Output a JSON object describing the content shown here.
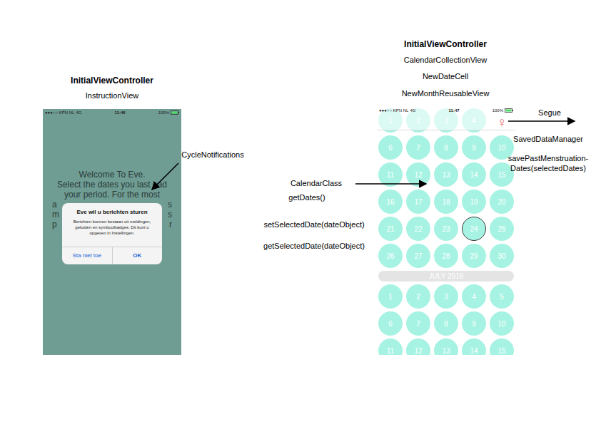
{
  "instruction_screen": {
    "labels": [
      "InitialViewController",
      "InstructionView"
    ],
    "status_bar": {
      "carrier": "●●●○○ KPN NL",
      "network": "4G",
      "time": "11:46",
      "battery": "100%"
    },
    "lines": [
      "Welcome To Eve.",
      "Select the dates you last had",
      "your period. For the most"
    ],
    "obscured_lines": [
      {
        "left": "a",
        "right": "s"
      },
      {
        "left": "m",
        "right": "s"
      },
      {
        "left": "p",
        "right": "r"
      }
    ],
    "alert": {
      "title": "Eve wil u berichten sturen",
      "message": "Berichten kunnen bestaan uit meldingen, geluiden en symboolbadges. Dit kunt u opgeven in Instellingen.",
      "buttons": [
        {
          "label": "Sta niet toe",
          "primary": false
        },
        {
          "label": "OK",
          "primary": true
        }
      ]
    }
  },
  "calendar_screen": {
    "labels": [
      "InitialViewController",
      "CalendarCollectionView",
      "NewDateCell",
      "NewMonthReusableView"
    ],
    "status_bar": {
      "carrier": "●●●○○ KPN NL",
      "network": "4G",
      "time": "11:47",
      "battery": "100%"
    },
    "menu_button": "♀",
    "months": [
      {
        "header": null,
        "days": [
          {
            "label": "1",
            "selected": false
          },
          {
            "label": "2",
            "selected": false
          },
          {
            "label": "3",
            "selected": false
          },
          {
            "label": "4",
            "selected": false
          },
          {
            "label": "6",
            "selected": false
          },
          {
            "label": "7",
            "selected": false
          },
          {
            "label": "8",
            "selected": false
          },
          {
            "label": "9",
            "selected": false
          },
          {
            "label": "10",
            "selected": false
          },
          {
            "label": "11",
            "selected": false
          },
          {
            "label": "12",
            "selected": false
          },
          {
            "label": "13",
            "selected": false
          },
          {
            "label": "14",
            "selected": false
          },
          {
            "label": "15",
            "selected": false
          },
          {
            "label": "16",
            "selected": false
          },
          {
            "label": "17",
            "selected": false
          },
          {
            "label": "18",
            "selected": false
          },
          {
            "label": "19",
            "selected": false
          },
          {
            "label": "20",
            "selected": false
          },
          {
            "label": "21",
            "selected": false
          },
          {
            "label": "22",
            "selected": false
          },
          {
            "label": "23",
            "selected": false
          },
          {
            "label": "24",
            "selected": true
          },
          {
            "label": "25",
            "selected": false
          },
          {
            "label": "26",
            "selected": false
          },
          {
            "label": "27",
            "selected": false
          },
          {
            "label": "28",
            "selected": false
          },
          {
            "label": "29",
            "selected": false
          },
          {
            "label": "30",
            "selected": false
          }
        ]
      },
      {
        "header": "JULY 2016",
        "days": [
          {
            "label": "1",
            "selected": false
          },
          {
            "label": "2",
            "selected": false
          },
          {
            "label": "3",
            "selected": false
          },
          {
            "label": "4",
            "selected": false
          },
          {
            "label": "5",
            "selected": false
          },
          {
            "label": "6",
            "selected": false
          },
          {
            "label": "7",
            "selected": false
          },
          {
            "label": "8",
            "selected": false
          },
          {
            "label": "9",
            "selected": false
          },
          {
            "label": "10",
            "selected": false
          },
          {
            "label": "11",
            "selected": false
          },
          {
            "label": "12",
            "selected": false
          },
          {
            "label": "13",
            "selected": false
          },
          {
            "label": "14",
            "selected": false
          },
          {
            "label": "15",
            "selected": false
          }
        ]
      }
    ]
  },
  "annotations": {
    "cycle_notifications": "CycleNotifications",
    "segue": "Segue",
    "saved_data_manager": "SavedDataManager",
    "save_method": [
      "savePastMenstruation-",
      "Dates(selectedDates)"
    ],
    "calendar_class": "CalendarClass",
    "calendar_methods": [
      "getDates()",
      "setSelectedDate(dateObject)",
      "getSelectedDate(dateObject)"
    ]
  }
}
